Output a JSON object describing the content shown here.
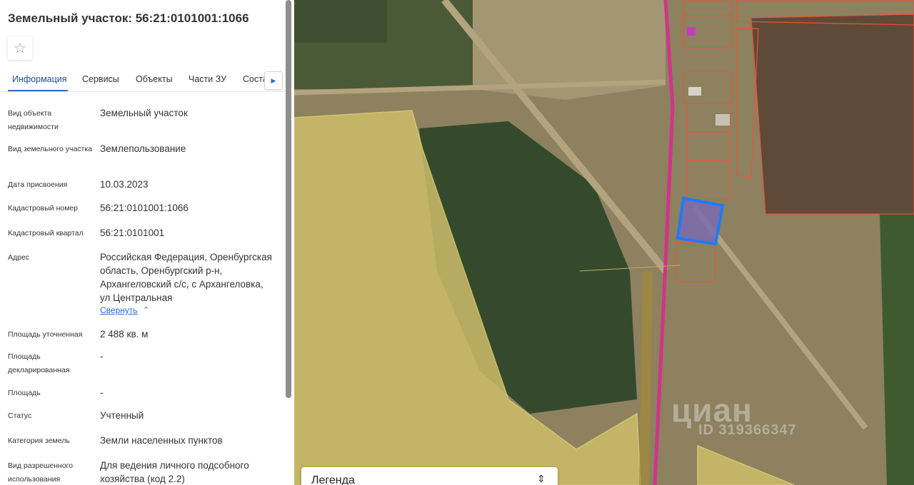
{
  "panel": {
    "title": "Земельный участок: 56:21:0101001:1066",
    "favorite_icon": "star-icon",
    "tabs": [
      {
        "label": "Информация"
      },
      {
        "label": "Сервисы"
      },
      {
        "label": "Объекты"
      },
      {
        "label": "Части ЗУ"
      },
      {
        "label": "Соста"
      }
    ],
    "tabs_scroll_icon": "chevron-right-icon",
    "fields": [
      {
        "label": "Вид объекта недвижимости",
        "value": "Земельный участок"
      },
      {
        "label": "Вид земельного участка",
        "value": "Землепользование"
      },
      {
        "label": "Дата присвоения",
        "value": "10.03.2023"
      },
      {
        "label": "Кадастровый номер",
        "value": "56:21:0101001:1066"
      },
      {
        "label": "Кадастровый квартал",
        "value": "56:21:0101001"
      },
      {
        "label": "Адрес",
        "value": "Российская Федерация, Оренбургская область, Оренбургский р-н, Архангеловский с/с, с Архангеловка, ул Центральная"
      },
      {
        "label": "Площадь уточненная",
        "value": "2 488 кв. м"
      },
      {
        "label": "Площадь декларированная",
        "value": "-"
      },
      {
        "label": "Площадь",
        "value": "-"
      },
      {
        "label": "Статус",
        "value": "Учтенный"
      },
      {
        "label": "Категория земель",
        "value": "Земли населенных пунктов"
      },
      {
        "label": "Вид разрешенного использования",
        "value": "Для ведения личного подсобного хозяйства (код 2.2)"
      }
    ],
    "collapse_link": "Свернуть",
    "collapse_icon": "chevron-up-icon"
  },
  "map": {
    "legend_title": "Легенда",
    "legend_toggle_icon": "expand-collapse-icon",
    "watermark_brand": "циан",
    "watermark_id": "ID 319366347",
    "colors": {
      "selected_parcel": "#1e7bff",
      "parcel_border": "#e8553a",
      "zone_fill": "#e6d66a",
      "road": "#d0358a"
    }
  }
}
